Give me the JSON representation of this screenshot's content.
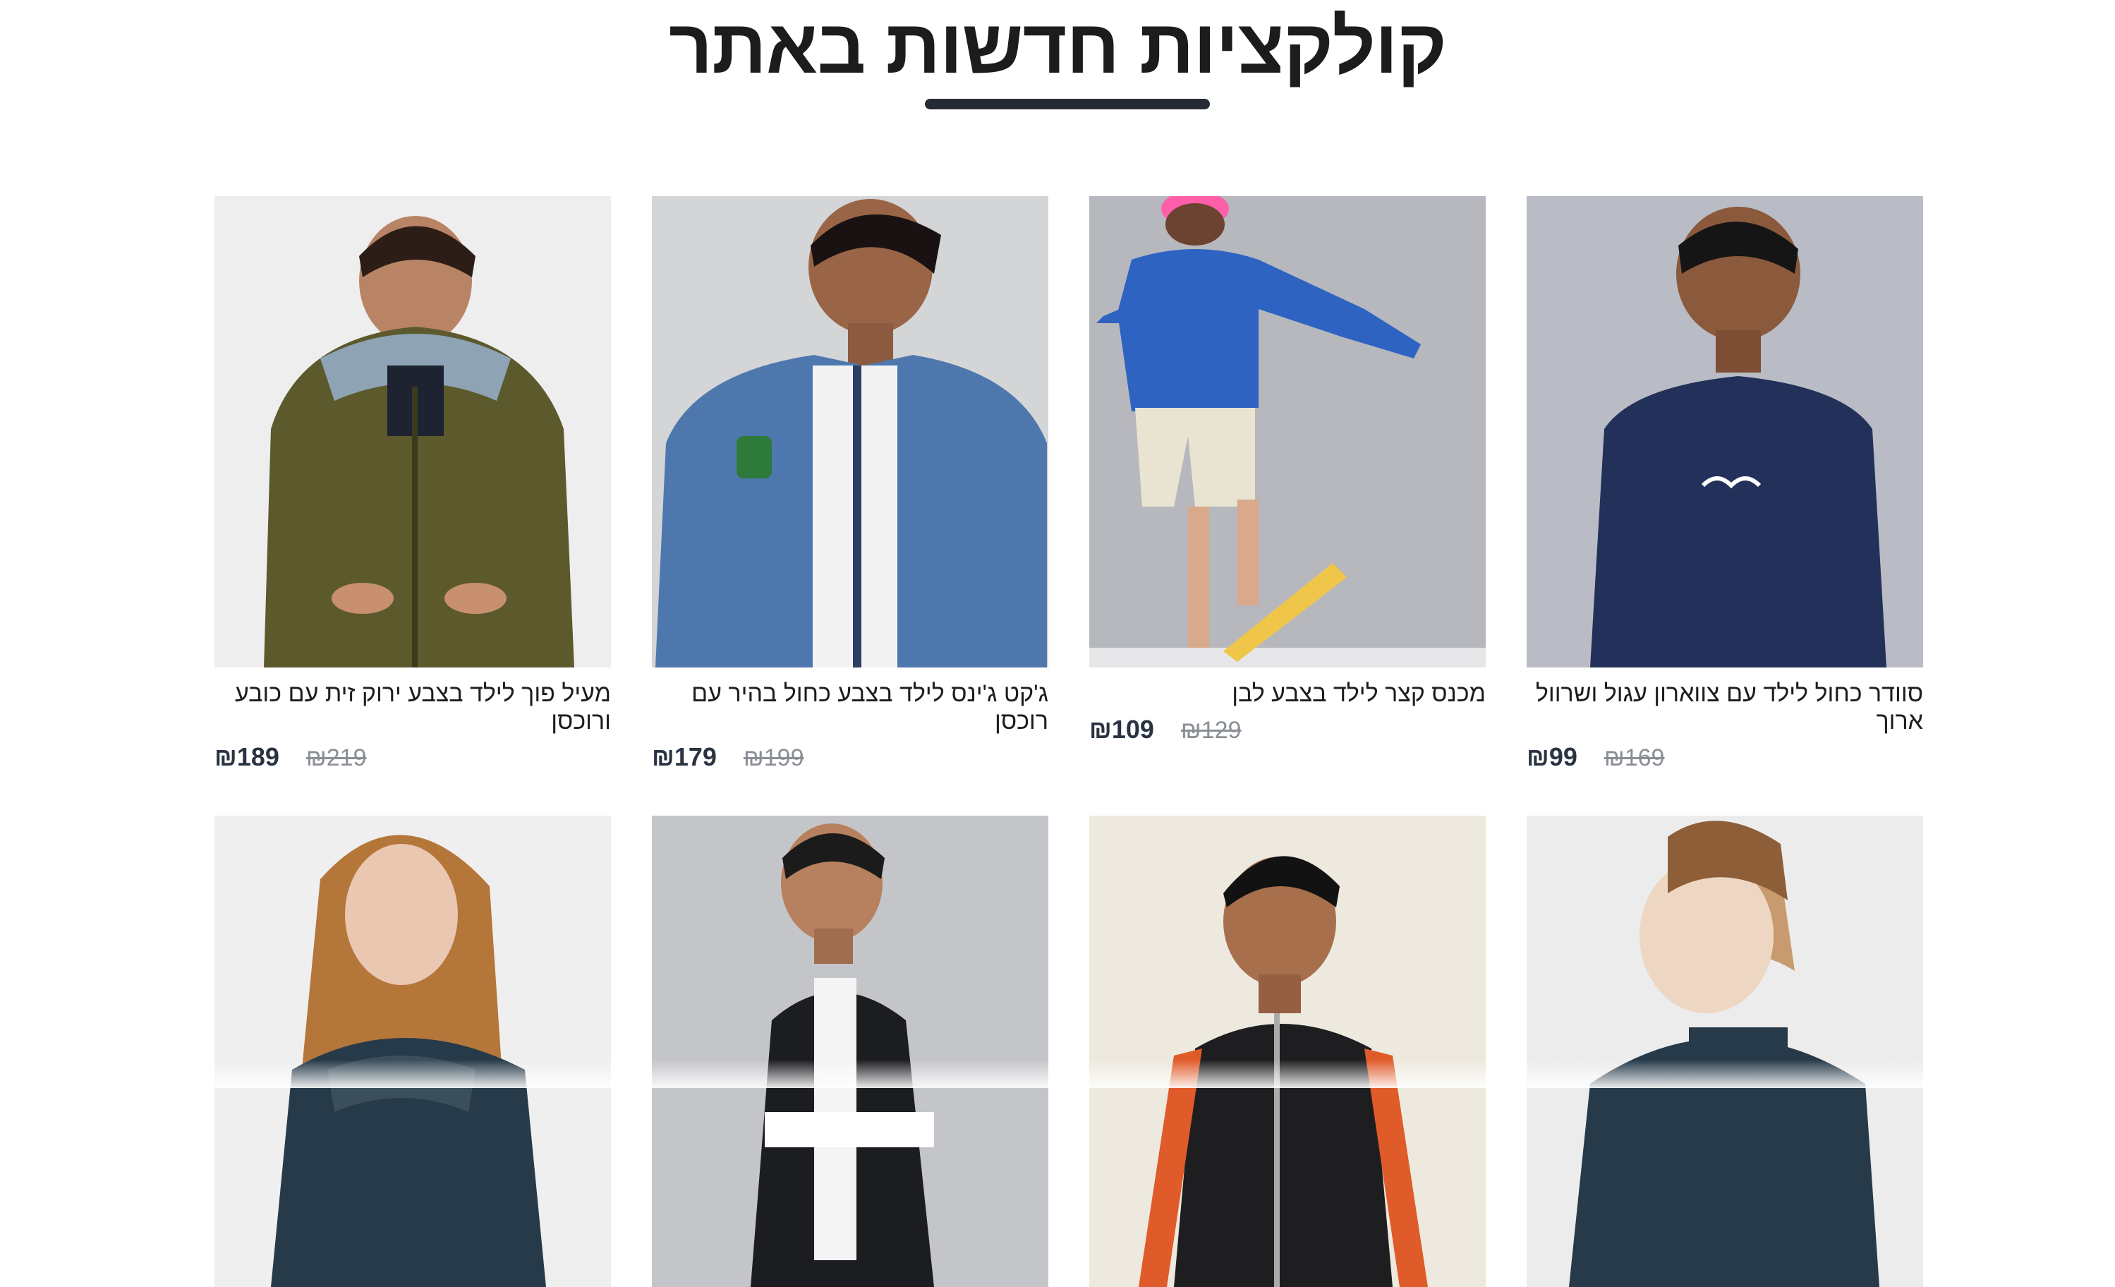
{
  "section": {
    "title": "קולקציות חדשות באתר"
  },
  "currency": "₪",
  "products": [
    {
      "name": "סוודר כחול לילד עם צווארון עגול ושרוול ארוך",
      "price": "₪99",
      "old_price": "₪169",
      "bg": "#b9bcc4",
      "garment": "#22305a"
    },
    {
      "name": "מכנס קצר לילד בצבע לבן",
      "price": "₪109",
      "old_price": "₪129",
      "bg": "#b7b8bd",
      "garment": "#2f63c2"
    },
    {
      "name": "ג'קט ג'ינס לילד בצבע כחול בהיר עם רוכסן",
      "price": "₪179",
      "old_price": "₪199",
      "bg": "#d4d5d7",
      "garment": "#4e78ad"
    },
    {
      "name": "מעיל פוך לילד בצבע ירוק זית עם כובע ורוכסן",
      "price": "₪189",
      "old_price": "₪219",
      "bg": "#eeeeee",
      "garment": "#5c5a2c"
    },
    {
      "name": "",
      "price": "",
      "old_price": "",
      "bg": "#ececec",
      "garment": "#1b2436"
    },
    {
      "name": "",
      "price": "",
      "old_price": "",
      "bg": "#c4c5c9",
      "garment": "#1c1d21"
    },
    {
      "name": "",
      "price": "",
      "old_price": "",
      "bg": "#eee9de",
      "garment": "#1e1e20"
    },
    {
      "name": "",
      "price": "",
      "old_price": "",
      "bg": "#efefef",
      "garment": "#263a4a"
    }
  ]
}
